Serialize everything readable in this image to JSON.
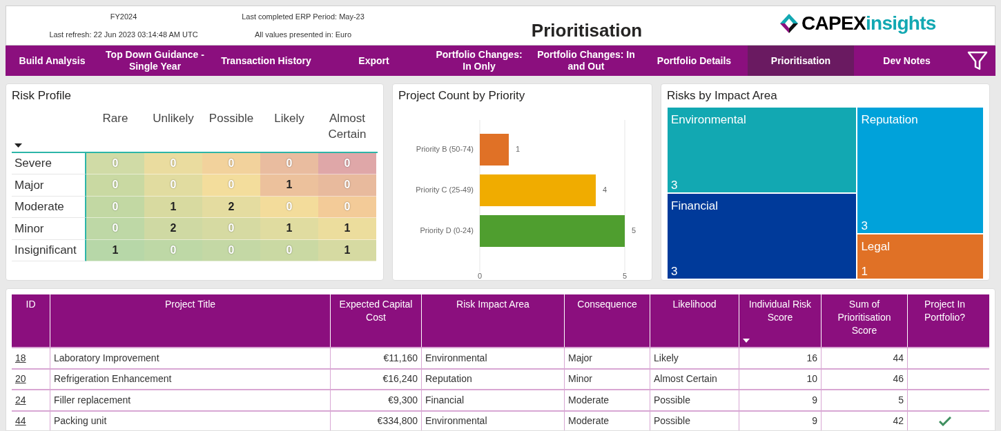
{
  "header": {
    "fiscal_year": "FY2024",
    "last_refresh": "Last refresh: 22 Jun 2023 03:14:48 AM UTC",
    "erp_period": "Last completed ERP Period: May-23",
    "currency_note": "All values presented in: Euro",
    "title": "Prioritisation",
    "logo": {
      "strong": "CAPEX",
      "light": "insights"
    }
  },
  "nav": [
    {
      "label": "Build Analysis",
      "selected": false
    },
    {
      "label": "Top Down Guidance - Single Year",
      "selected": false
    },
    {
      "label": "Transaction History",
      "selected": false
    },
    {
      "label": "Export",
      "selected": false
    },
    {
      "label": "Portfolio Changes: In Only",
      "selected": false
    },
    {
      "label": "Portfolio Changes: In and Out",
      "selected": false
    },
    {
      "label": "Portfolio Details",
      "selected": false
    },
    {
      "label": "Prioritisation",
      "selected": true
    },
    {
      "label": "Dev Notes",
      "selected": false
    }
  ],
  "risk_profile": {
    "title": "Risk Profile",
    "columns": [
      "Rare",
      "Unlikely",
      "Possible",
      "Likely",
      "Almost Certain"
    ],
    "rows": [
      {
        "label": "Severe",
        "cells": [
          {
            "value": "0",
            "faded": true,
            "color": "#d0dba6"
          },
          {
            "value": "0",
            "faded": true,
            "color": "#eadc9f"
          },
          {
            "value": "0",
            "faded": true,
            "color": "#f2d29c"
          },
          {
            "value": "0",
            "faded": true,
            "color": "#e9bc9f"
          },
          {
            "value": "0",
            "faded": true,
            "color": "#dfa7a8"
          }
        ]
      },
      {
        "label": "Major",
        "cells": [
          {
            "value": "0",
            "faded": true,
            "color": "#c9d9a2"
          },
          {
            "value": "0",
            "faded": true,
            "color": "#e1dca0"
          },
          {
            "value": "0",
            "faded": true,
            "color": "#f3dd9c"
          },
          {
            "value": "1",
            "faded": false,
            "color": "#ecc19c"
          },
          {
            "value": "0",
            "faded": true,
            "color": "#e8ba9d"
          }
        ]
      },
      {
        "label": "Moderate",
        "cells": [
          {
            "value": "0",
            "faded": true,
            "color": "#c2d8a3"
          },
          {
            "value": "1",
            "faded": false,
            "color": "#d8daa0"
          },
          {
            "value": "2",
            "faded": false,
            "color": "#e4dca0"
          },
          {
            "value": "0",
            "faded": true,
            "color": "#f3dc9b"
          },
          {
            "value": "0",
            "faded": true,
            "color": "#f3cb98"
          }
        ]
      },
      {
        "label": "Minor",
        "cells": [
          {
            "value": "0",
            "faded": true,
            "color": "#bed8a6"
          },
          {
            "value": "2",
            "faded": false,
            "color": "#cfd9a3"
          },
          {
            "value": "0",
            "faded": true,
            "color": "#d6daa2"
          },
          {
            "value": "1",
            "faded": false,
            "color": "#e0dca0"
          },
          {
            "value": "1",
            "faded": false,
            "color": "#ecdd9d"
          }
        ]
      },
      {
        "label": "Insignificant",
        "cells": [
          {
            "value": "1",
            "faded": false,
            "color": "#b7d7a8"
          },
          {
            "value": "0",
            "faded": true,
            "color": "#bed8a6"
          },
          {
            "value": "0",
            "faded": true,
            "color": "#c4d8a5"
          },
          {
            "value": "0",
            "faded": true,
            "color": "#cad9a3"
          },
          {
            "value": "1",
            "faded": false,
            "color": "#d6daa2"
          }
        ]
      }
    ]
  },
  "priority_chart": {
    "title": "Project Count by Priority",
    "chart_data": {
      "type": "bar",
      "orientation": "horizontal",
      "categories": [
        "Priority B (50-74)",
        "Priority C (25-49)",
        "Priority D (0-24)"
      ],
      "series": [
        {
          "values": [
            1,
            4,
            5
          ]
        }
      ],
      "xlim": [
        0,
        5
      ],
      "xticks": [
        0,
        5
      ],
      "data_labels": true
    },
    "bars": [
      {
        "color": "#e07126"
      },
      {
        "color": "#f0ac00"
      },
      {
        "color": "#4f9e2f"
      }
    ]
  },
  "impact_treemap": {
    "title": "Risks by Impact Area",
    "areas": [
      {
        "name": "Environmental",
        "value": "3",
        "color": "#12a8b2"
      },
      {
        "name": "Financial",
        "value": "3",
        "color": "#003a9a"
      },
      {
        "name": "Reputation",
        "value": "3",
        "color": "#00a2da"
      },
      {
        "name": "Legal",
        "value": "1",
        "color": "#e07126"
      }
    ]
  },
  "table": {
    "columns": [
      {
        "label": "ID",
        "sorted": false
      },
      {
        "label": "Project Title",
        "sorted": false
      },
      {
        "label": "Expected Capital Cost",
        "sorted": false
      },
      {
        "label": "Risk Impact Area",
        "sorted": false
      },
      {
        "label": "Consequence",
        "sorted": false
      },
      {
        "label": "Likelihood",
        "sorted": false
      },
      {
        "label": "Individual Risk Score",
        "sorted": true
      },
      {
        "label": "Sum of Prioritisation Score",
        "sorted": false
      },
      {
        "label": "Project In Portfolio?",
        "sorted": false
      }
    ],
    "rows": [
      {
        "id": "18",
        "title": "Laboratory Improvement",
        "cost": "€11,160",
        "area": "Environmental",
        "consequence": "Major",
        "likelihood": "Likely",
        "risk_score": "16",
        "priority_score": "44",
        "in_portfolio": false
      },
      {
        "id": "20",
        "title": "Refrigeration Enhancement",
        "cost": "€16,240",
        "area": "Reputation",
        "consequence": "Minor",
        "likelihood": "Almost Certain",
        "risk_score": "10",
        "priority_score": "46",
        "in_portfolio": false
      },
      {
        "id": "24",
        "title": "Filler replacement",
        "cost": "€9,300",
        "area": "Financial",
        "consequence": "Moderate",
        "likelihood": "Possible",
        "risk_score": "9",
        "priority_score": "5",
        "in_portfolio": false
      },
      {
        "id": "44",
        "title": "Packing unit",
        "cost": "€334,800",
        "area": "Environmental",
        "consequence": "Moderate",
        "likelihood": "Possible",
        "risk_score": "9",
        "priority_score": "42",
        "in_portfolio": true
      }
    ]
  }
}
